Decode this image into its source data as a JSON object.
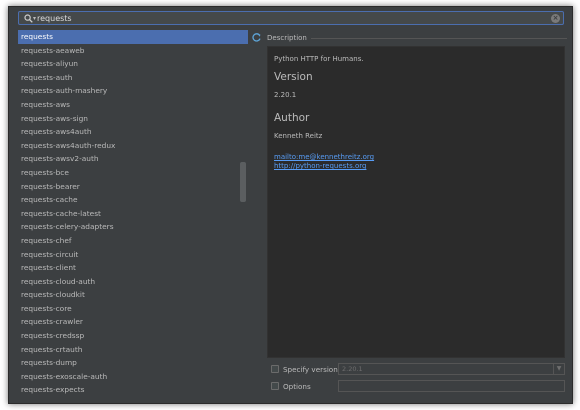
{
  "search": {
    "value": "requests"
  },
  "packages": [
    "requests",
    "requests-aeaweb",
    "requests-aliyun",
    "requests-auth",
    "requests-auth-mashery",
    "requests-aws",
    "requests-aws-sign",
    "requests-aws4auth",
    "requests-aws4auth-redux",
    "requests-awsv2-auth",
    "requests-bce",
    "requests-bearer",
    "requests-cache",
    "requests-cache-latest",
    "requests-celery-adapters",
    "requests-chef",
    "requests-circuit",
    "requests-client",
    "requests-cloud-auth",
    "requests-cloudkit",
    "requests-core",
    "requests-crawler",
    "requests-credssp",
    "requests-crtauth",
    "requests-dump",
    "requests-exoscale-auth",
    "requests-expects"
  ],
  "selected_index": 0,
  "description": {
    "header": "Description",
    "summary": "Python HTTP for Humans.",
    "version_heading": "Version",
    "version": "2.20.1",
    "author_heading": "Author",
    "author": "Kenneth Reitz",
    "links": [
      "mailto:me@kennethreitz.org",
      "http://python-requests.org"
    ]
  },
  "options": {
    "specify_version_label": "Specify version",
    "specify_version_value": "2.20.1",
    "options_label": "Options",
    "options_value": ""
  },
  "icons": {
    "search": "search-icon",
    "clear": "clear-search-icon",
    "refresh": "refresh-icon",
    "dropdown": "chevron-down-icon"
  },
  "colors": {
    "selection": "#4b6eaf",
    "link": "#589df6",
    "background": "#3c3f41",
    "panel": "#2b2b2b"
  }
}
